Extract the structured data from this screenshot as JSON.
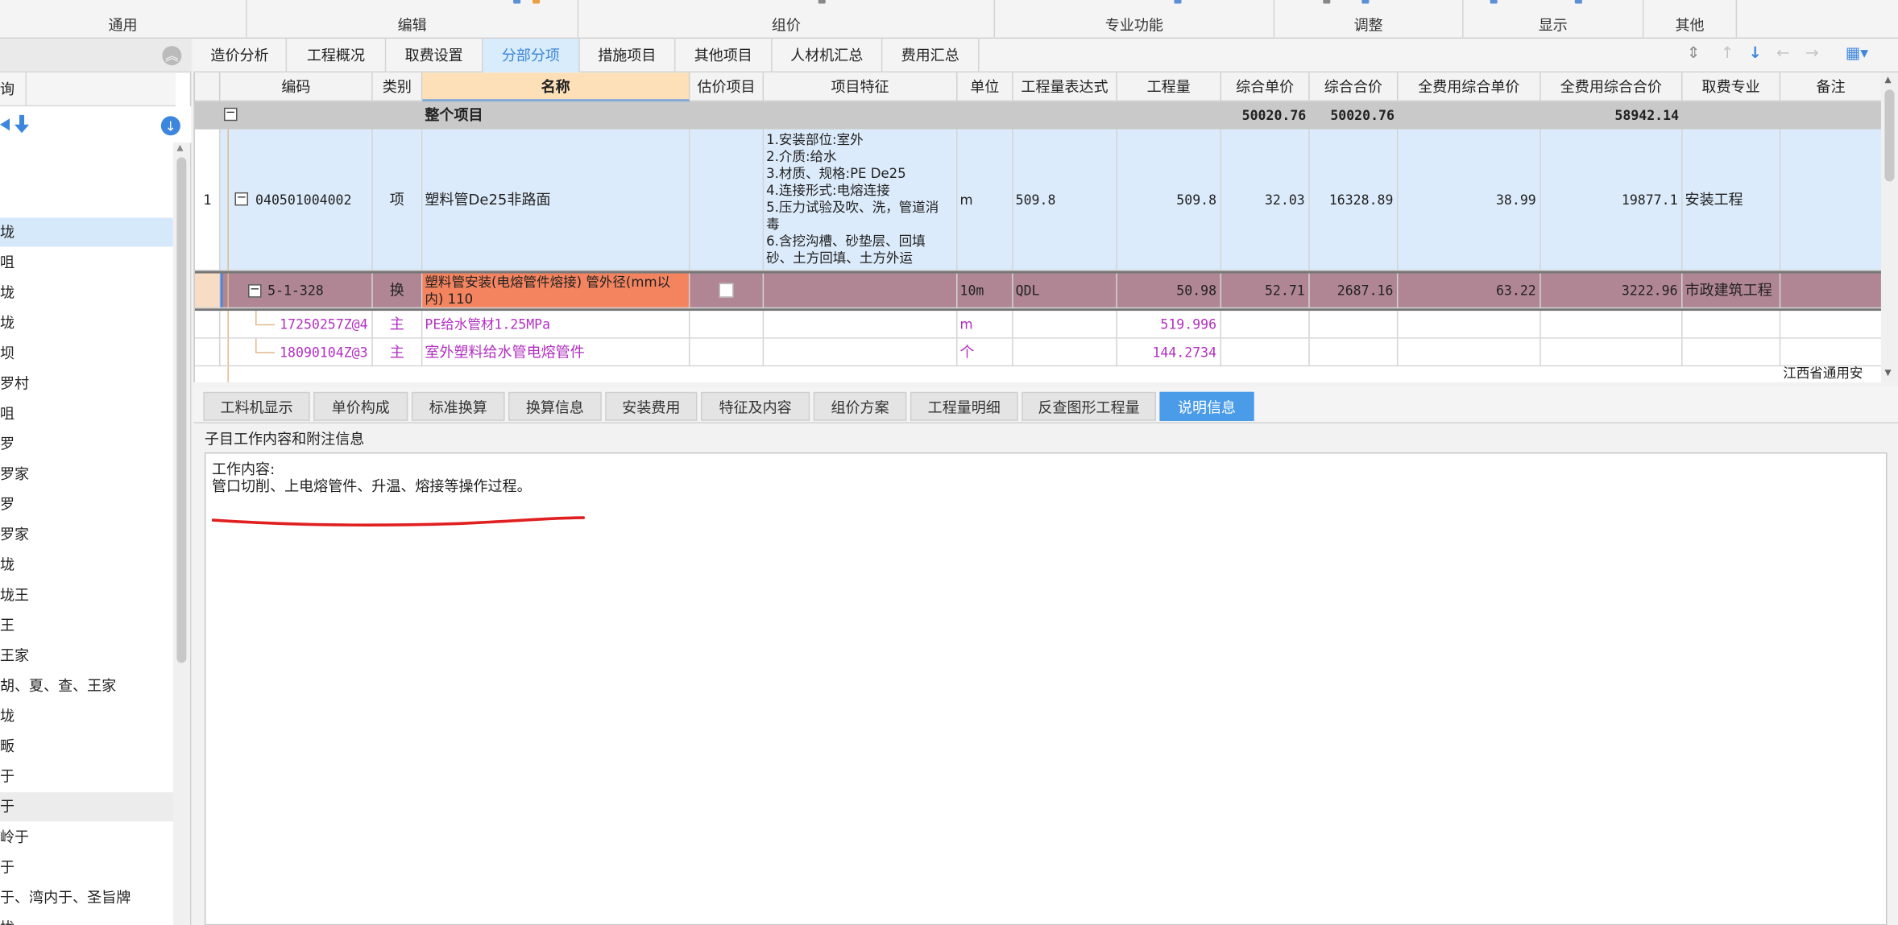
{
  "ribbon": {
    "groups": [
      "通用",
      "编辑",
      "组价",
      "专业功能",
      "调整",
      "显示",
      "其他"
    ]
  },
  "sidebar": {
    "header_col": "询",
    "items": [
      "垅",
      "咀",
      "垅",
      "垅",
      "坝",
      "罗村",
      "咀",
      "罗",
      "罗家",
      "罗",
      "罗家",
      "垅",
      "垅王",
      "王",
      "王家",
      "胡、夏、查、王家",
      "垅",
      "畈",
      "于",
      "于",
      "岭于",
      "于",
      "于、湾内于、圣旨牌",
      "垅"
    ],
    "selected_index": 0
  },
  "tabs": [
    "造价分析",
    "工程概况",
    "取费设置",
    "分部分项",
    "措施项目",
    "其他项目",
    "人材机汇总",
    "费用汇总"
  ],
  "active_tab": "分部分项",
  "grid": {
    "headers": [
      "编码",
      "类别",
      "名称",
      "估价项目",
      "项目特征",
      "单位",
      "工程量表达式",
      "工程量",
      "综合单价",
      "综合合价",
      "全费用综合单价",
      "全费用综合合价",
      "取费专业",
      "备注"
    ],
    "total_row": {
      "label": "整个项目",
      "unit_total": "50020.76",
      "total": "50020.76",
      "full_total": "58942.14"
    },
    "item_row": {
      "num": "1",
      "code": "040501004002",
      "type": "项",
      "name": "塑料管De25非路面",
      "features": [
        "1.安装部位:室外",
        "2.介质:给水",
        "3.材质、规格:PE De25",
        "4.连接形式:电熔连接",
        "5.压力试验及吹、洗，管道消",
        "毒",
        "6.含挖沟槽、砂垫层、回填",
        "砂、土方回填、土方外运"
      ],
      "unit": "m",
      "expr": "509.8",
      "qty": "509.8",
      "unit_price": "32.03",
      "total_price": "16328.89",
      "full_unit": "38.99",
      "full_total": "19877.1",
      "fee": "安装工程"
    },
    "quota_row": {
      "code": "5-1-328",
      "type": "换",
      "name_line1": "塑料管安装(电熔管件熔接) 管外径(mm以",
      "name_line2": "内) 110",
      "unit": "10m",
      "expr": "QDL",
      "qty": "50.98",
      "unit_price": "52.71",
      "total_price": "2687.16",
      "full_unit": "63.22",
      "full_total": "3222.96",
      "fee": "市政建筑工程"
    },
    "material_rows": [
      {
        "code": "17250257Z@4",
        "type": "主",
        "name": "PE给水管材1.25MPa",
        "unit": "m",
        "qty": "519.996"
      },
      {
        "code": "18090104Z@3",
        "type": "主",
        "name": "室外塑料给水管电熔管件",
        "unit": "个",
        "qty": "144.2734"
      }
    ],
    "partial_remark": "江西省通用安"
  },
  "bottom_tabs": [
    "工料机显示",
    "单价构成",
    "标准换算",
    "换算信息",
    "安装费用",
    "特征及内容",
    "组价方案",
    "工程量明细",
    "反查图形工程量",
    "说明信息"
  ],
  "active_bottom_tab": "说明信息",
  "description": {
    "title": "子目工作内容和附注信息",
    "line1": "工作内容:",
    "line2": "管口切削、上电熔管件、升温、熔接等操作过程。"
  },
  "colors": {
    "accent": "#4a9be8",
    "quota_row": "#b08694",
    "quota_name": "#f4845f",
    "item_row": "#dcebfb",
    "material_text": "#b22fc0",
    "annotation": "#e02020"
  }
}
